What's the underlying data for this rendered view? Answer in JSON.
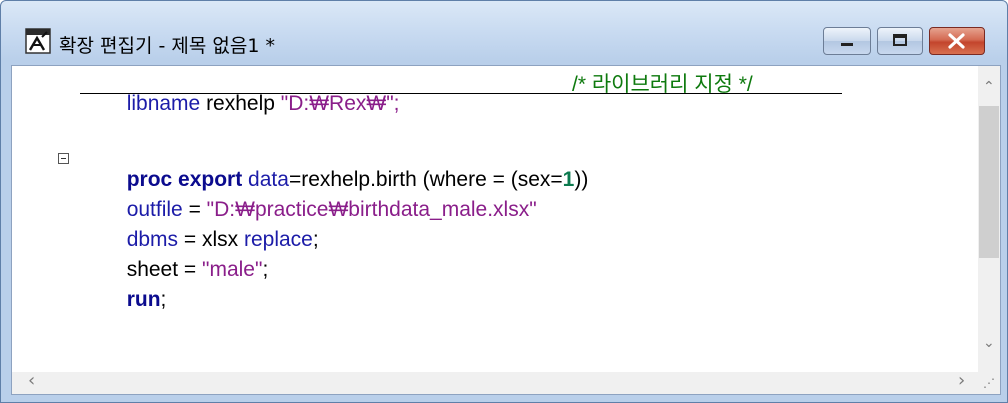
{
  "window": {
    "title": "확장 편집기 - 제목 없음1 *"
  },
  "editor": {
    "lines": [
      {
        "parts": [
          "libname",
          " rexhelp ",
          "\"D:₩Rex₩\";",
          "/* 라이브러리 지정 */"
        ]
      },
      {
        "parts": []
      },
      {
        "parts": [
          "proc export",
          " data",
          "=rexhelp.birth (where = (sex=",
          "1",
          "))"
        ]
      },
      {
        "parts": [
          "outfile",
          " = ",
          "\"D:₩practice₩birthdata_male.xlsx\""
        ]
      },
      {
        "parts": [
          "dbms",
          " = xlsx ",
          "replace",
          ";"
        ]
      },
      {
        "parts": [
          "sheet = ",
          "\"male\"",
          ";"
        ]
      },
      {
        "parts": [
          "run",
          ";"
        ]
      }
    ]
  },
  "scrollbars": {
    "up_arrow": "⌃",
    "down_arrow": "⌄",
    "left_arrow": "‹",
    "right_arrow": "›",
    "grip": "⋰"
  },
  "colors": {
    "keyword": "#1c1ca8",
    "keyword_bold": "#0b0b8e",
    "string": "#8a1e8a",
    "comment": "#0e7a0e",
    "number": "#0c7a4e"
  }
}
